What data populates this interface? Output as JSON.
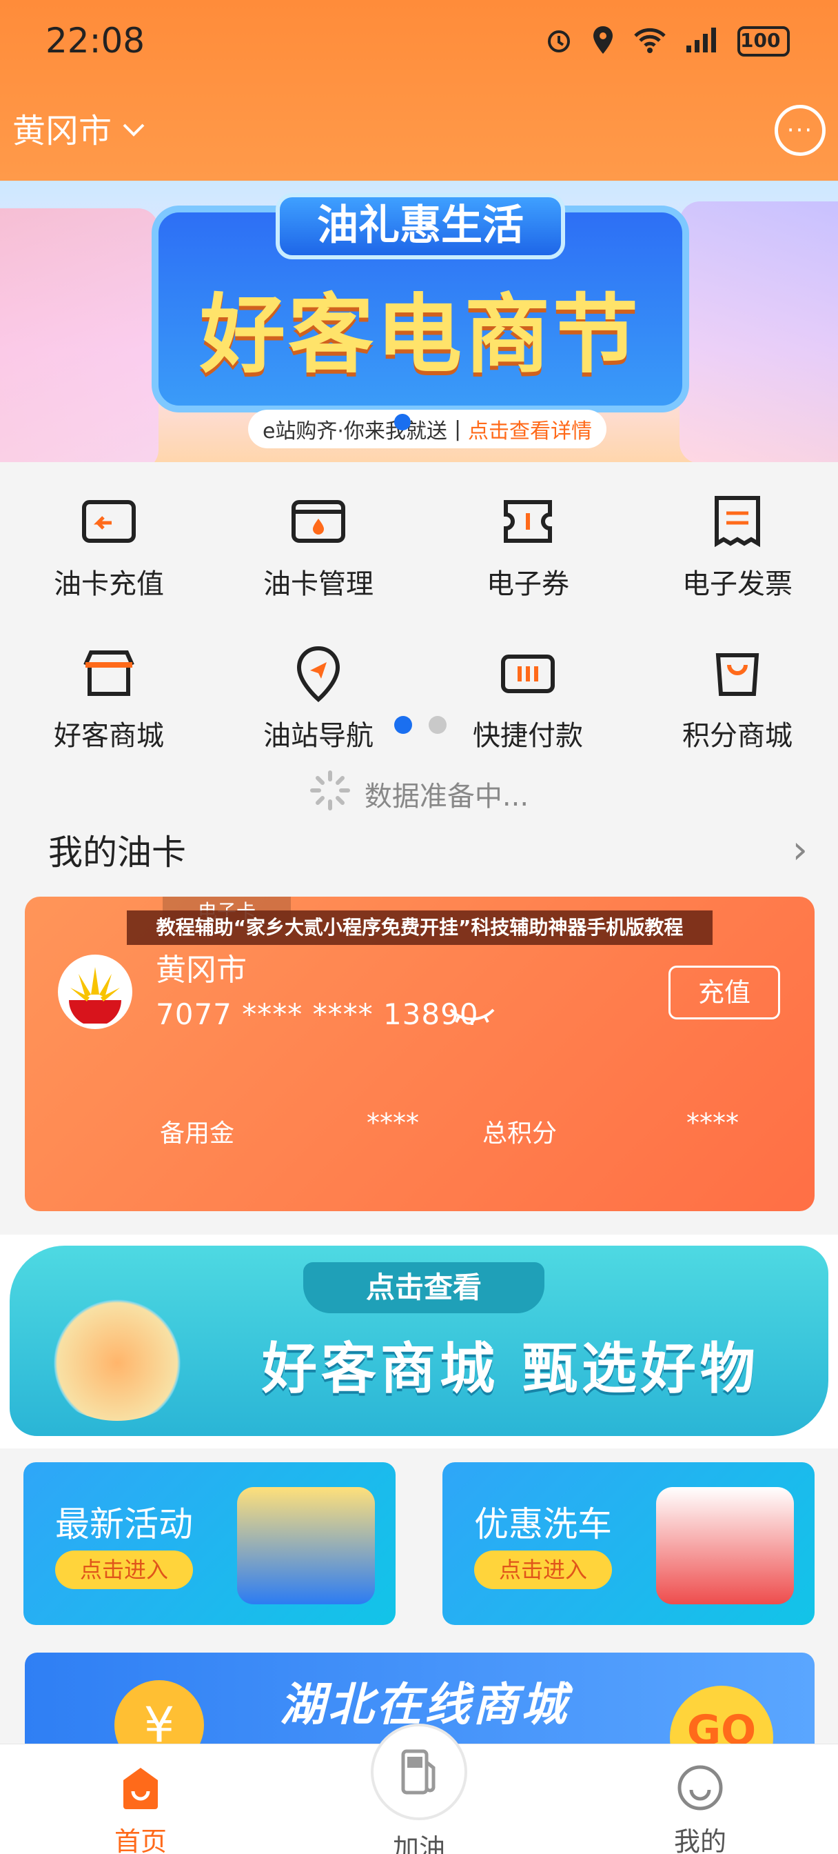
{
  "status": {
    "time": "22:08",
    "battery": "100"
  },
  "header": {
    "city": "黄冈市",
    "chevron": "chevron-down-icon",
    "message": "chat-icon"
  },
  "banner": {
    "ribbon": "油礼惠生活",
    "headline": "好客电商节",
    "sub_prefix": "e站购齐·你来我就送",
    "sub_link": "点击查看详情"
  },
  "grid": [
    {
      "label": "油卡充值",
      "icon": "card-recharge-icon"
    },
    {
      "label": "油卡管理",
      "icon": "card-manage-icon"
    },
    {
      "label": "电子券",
      "icon": "ticket-icon"
    },
    {
      "label": "电子发票",
      "icon": "invoice-icon"
    },
    {
      "label": "好客商城",
      "icon": "store-icon"
    },
    {
      "label": "油站导航",
      "icon": "navigation-icon"
    },
    {
      "label": "快捷付款",
      "icon": "quick-pay-icon"
    },
    {
      "label": "积分商城",
      "icon": "shopping-bag-icon"
    }
  ],
  "loading": "数据准备中...",
  "my_card": {
    "title": "我的油卡",
    "tag": "电子卡",
    "city": "黄冈市",
    "number": "7077 **** **** 13890",
    "charge": "充值",
    "reserve_label": "备用金",
    "reserve_value": "****",
    "points_label": "总积分",
    "points_value": "****"
  },
  "watermark": "教程辅助“家乡大贰小程序免费开挂”科技辅助神器手机版教程",
  "mall": {
    "chip": "点击查看",
    "headline": "好客商城 甄选好物"
  },
  "tiles": [
    {
      "title": "最新活动",
      "button": "点击进入"
    },
    {
      "title": "优惠洗车",
      "button": "点击进入"
    }
  ],
  "hubei": {
    "title": "湖北在线商城",
    "coin": "¥",
    "go": "GO"
  },
  "nav": {
    "home": "首页",
    "fuel": "加油",
    "mine": "我的"
  },
  "colors": {
    "brand_orange": "#ff8c3a",
    "accent_blue": "#1a6ff0",
    "highlight_orange": "#ff6a1a"
  }
}
